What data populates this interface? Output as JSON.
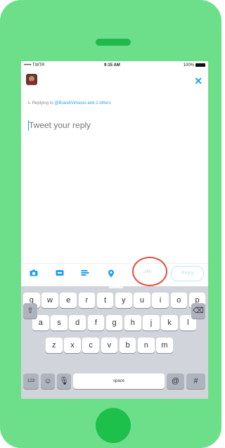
{
  "status_bar": {
    "carrier": "••••• TWTR",
    "time": "9:15 AM",
    "battery": "100%"
  },
  "header": {
    "avatar_icon": "user-avatar-icon",
    "close_label": "✕"
  },
  "reply": {
    "prefix": "Replying to",
    "handles": "@BrandiVirtuoso and 2 others"
  },
  "compose": {
    "placeholder": "Tweet your reply"
  },
  "toolbar": {
    "icons": [
      "camera-icon",
      "gif-icon",
      "poll-icon",
      "location-icon"
    ],
    "char_count": "140",
    "reply_label": "Reply"
  },
  "keyboard": {
    "row1": [
      "q",
      "w",
      "e",
      "r",
      "t",
      "y",
      "u",
      "i",
      "o",
      "p"
    ],
    "row2": [
      "a",
      "s",
      "d",
      "f",
      "g",
      "h",
      "j",
      "k",
      "l"
    ],
    "row3": [
      "z",
      "x",
      "c",
      "v",
      "b",
      "n",
      "m"
    ],
    "num_label": "123",
    "space_label": "space"
  },
  "colors": {
    "phone": "#6ddf8b",
    "accent": "#1da1f2",
    "highlight": "#e74c3c"
  }
}
